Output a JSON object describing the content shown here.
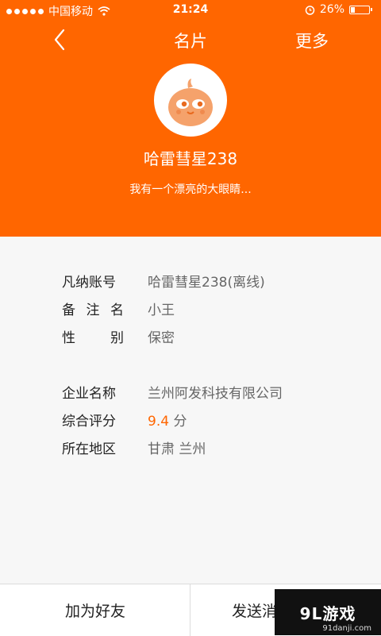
{
  "statusbar": {
    "carrier": "中国移动",
    "time": "21:24",
    "battery_text": "26%",
    "battery_level": 0.26
  },
  "navbar": {
    "back_icon": "chevron-left-icon",
    "title": "名片",
    "more_label": "更多"
  },
  "profile": {
    "avatar_icon": "bird-avatar-icon",
    "name": "哈雷彗星238",
    "signature": "我有一个漂亮的大眼睛..."
  },
  "details": {
    "account_label": "凡纳账号",
    "account_value": "哈雷彗星238(离线)",
    "remark_label_chars": [
      "备",
      "注",
      "名"
    ],
    "remark_value": "小王",
    "gender_label_chars": [
      "性",
      "别"
    ],
    "gender_value": "保密",
    "company_label": "企业名称",
    "company_value": "兰州阿发科技有限公司",
    "rating_label": "综合评分",
    "rating_value": "9.4",
    "rating_unit": "分",
    "region_label": "所在地区",
    "region_value": "甘肃 兰州"
  },
  "bottombar": {
    "add_friend_label": "加为好友",
    "send_message_label": "发送消"
  },
  "watermark": {
    "text": "9L游戏",
    "domain": "91danji.com"
  },
  "colors": {
    "accent": "#ff6600",
    "link": "#1f74c9"
  }
}
